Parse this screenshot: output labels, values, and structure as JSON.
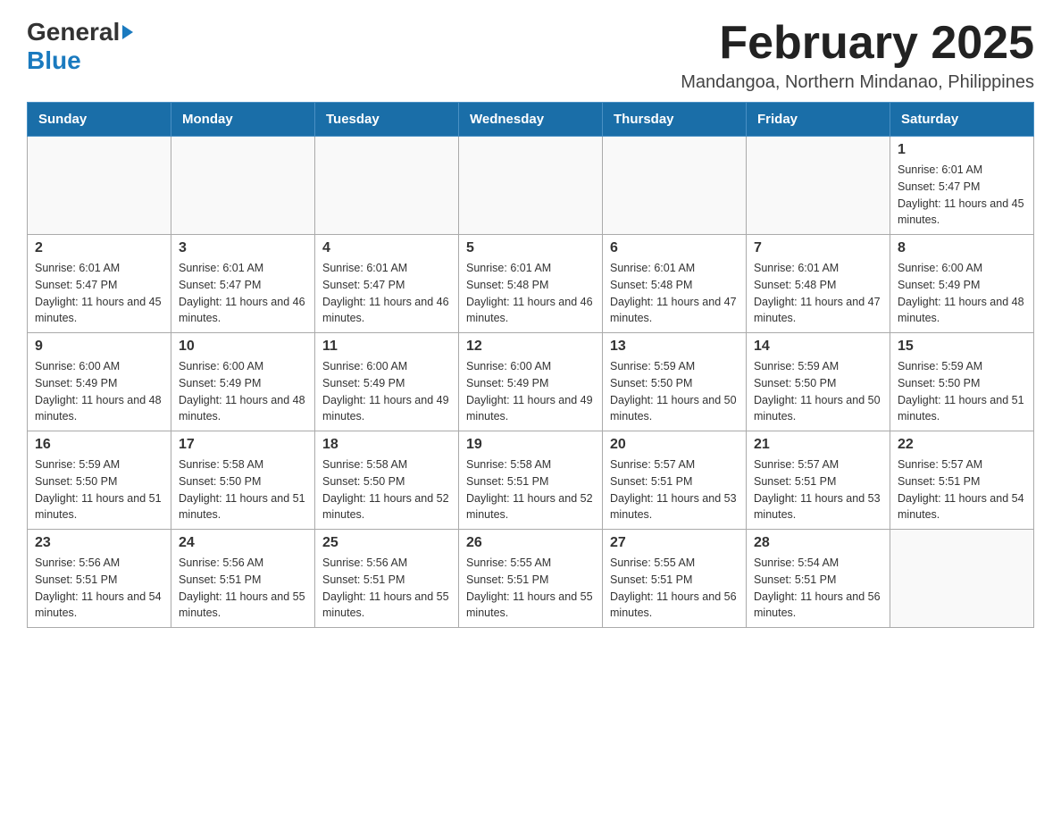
{
  "header": {
    "logo_general": "General",
    "logo_blue": "Blue",
    "month_title": "February 2025",
    "location": "Mandangoa, Northern Mindanao, Philippines"
  },
  "days_of_week": [
    "Sunday",
    "Monday",
    "Tuesday",
    "Wednesday",
    "Thursday",
    "Friday",
    "Saturday"
  ],
  "weeks": [
    {
      "days": [
        {
          "number": "",
          "sunrise": "",
          "sunset": "",
          "daylight": "",
          "empty": true
        },
        {
          "number": "",
          "sunrise": "",
          "sunset": "",
          "daylight": "",
          "empty": true
        },
        {
          "number": "",
          "sunrise": "",
          "sunset": "",
          "daylight": "",
          "empty": true
        },
        {
          "number": "",
          "sunrise": "",
          "sunset": "",
          "daylight": "",
          "empty": true
        },
        {
          "number": "",
          "sunrise": "",
          "sunset": "",
          "daylight": "",
          "empty": true
        },
        {
          "number": "",
          "sunrise": "",
          "sunset": "",
          "daylight": "",
          "empty": true
        },
        {
          "number": "1",
          "sunrise": "Sunrise: 6:01 AM",
          "sunset": "Sunset: 5:47 PM",
          "daylight": "Daylight: 11 hours and 45 minutes.",
          "empty": false
        }
      ]
    },
    {
      "days": [
        {
          "number": "2",
          "sunrise": "Sunrise: 6:01 AM",
          "sunset": "Sunset: 5:47 PM",
          "daylight": "Daylight: 11 hours and 45 minutes.",
          "empty": false
        },
        {
          "number": "3",
          "sunrise": "Sunrise: 6:01 AM",
          "sunset": "Sunset: 5:47 PM",
          "daylight": "Daylight: 11 hours and 46 minutes.",
          "empty": false
        },
        {
          "number": "4",
          "sunrise": "Sunrise: 6:01 AM",
          "sunset": "Sunset: 5:47 PM",
          "daylight": "Daylight: 11 hours and 46 minutes.",
          "empty": false
        },
        {
          "number": "5",
          "sunrise": "Sunrise: 6:01 AM",
          "sunset": "Sunset: 5:48 PM",
          "daylight": "Daylight: 11 hours and 46 minutes.",
          "empty": false
        },
        {
          "number": "6",
          "sunrise": "Sunrise: 6:01 AM",
          "sunset": "Sunset: 5:48 PM",
          "daylight": "Daylight: 11 hours and 47 minutes.",
          "empty": false
        },
        {
          "number": "7",
          "sunrise": "Sunrise: 6:01 AM",
          "sunset": "Sunset: 5:48 PM",
          "daylight": "Daylight: 11 hours and 47 minutes.",
          "empty": false
        },
        {
          "number": "8",
          "sunrise": "Sunrise: 6:00 AM",
          "sunset": "Sunset: 5:49 PM",
          "daylight": "Daylight: 11 hours and 48 minutes.",
          "empty": false
        }
      ]
    },
    {
      "days": [
        {
          "number": "9",
          "sunrise": "Sunrise: 6:00 AM",
          "sunset": "Sunset: 5:49 PM",
          "daylight": "Daylight: 11 hours and 48 minutes.",
          "empty": false
        },
        {
          "number": "10",
          "sunrise": "Sunrise: 6:00 AM",
          "sunset": "Sunset: 5:49 PM",
          "daylight": "Daylight: 11 hours and 48 minutes.",
          "empty": false
        },
        {
          "number": "11",
          "sunrise": "Sunrise: 6:00 AM",
          "sunset": "Sunset: 5:49 PM",
          "daylight": "Daylight: 11 hours and 49 minutes.",
          "empty": false
        },
        {
          "number": "12",
          "sunrise": "Sunrise: 6:00 AM",
          "sunset": "Sunset: 5:49 PM",
          "daylight": "Daylight: 11 hours and 49 minutes.",
          "empty": false
        },
        {
          "number": "13",
          "sunrise": "Sunrise: 5:59 AM",
          "sunset": "Sunset: 5:50 PM",
          "daylight": "Daylight: 11 hours and 50 minutes.",
          "empty": false
        },
        {
          "number": "14",
          "sunrise": "Sunrise: 5:59 AM",
          "sunset": "Sunset: 5:50 PM",
          "daylight": "Daylight: 11 hours and 50 minutes.",
          "empty": false
        },
        {
          "number": "15",
          "sunrise": "Sunrise: 5:59 AM",
          "sunset": "Sunset: 5:50 PM",
          "daylight": "Daylight: 11 hours and 51 minutes.",
          "empty": false
        }
      ]
    },
    {
      "days": [
        {
          "number": "16",
          "sunrise": "Sunrise: 5:59 AM",
          "sunset": "Sunset: 5:50 PM",
          "daylight": "Daylight: 11 hours and 51 minutes.",
          "empty": false
        },
        {
          "number": "17",
          "sunrise": "Sunrise: 5:58 AM",
          "sunset": "Sunset: 5:50 PM",
          "daylight": "Daylight: 11 hours and 51 minutes.",
          "empty": false
        },
        {
          "number": "18",
          "sunrise": "Sunrise: 5:58 AM",
          "sunset": "Sunset: 5:50 PM",
          "daylight": "Daylight: 11 hours and 52 minutes.",
          "empty": false
        },
        {
          "number": "19",
          "sunrise": "Sunrise: 5:58 AM",
          "sunset": "Sunset: 5:51 PM",
          "daylight": "Daylight: 11 hours and 52 minutes.",
          "empty": false
        },
        {
          "number": "20",
          "sunrise": "Sunrise: 5:57 AM",
          "sunset": "Sunset: 5:51 PM",
          "daylight": "Daylight: 11 hours and 53 minutes.",
          "empty": false
        },
        {
          "number": "21",
          "sunrise": "Sunrise: 5:57 AM",
          "sunset": "Sunset: 5:51 PM",
          "daylight": "Daylight: 11 hours and 53 minutes.",
          "empty": false
        },
        {
          "number": "22",
          "sunrise": "Sunrise: 5:57 AM",
          "sunset": "Sunset: 5:51 PM",
          "daylight": "Daylight: 11 hours and 54 minutes.",
          "empty": false
        }
      ]
    },
    {
      "days": [
        {
          "number": "23",
          "sunrise": "Sunrise: 5:56 AM",
          "sunset": "Sunset: 5:51 PM",
          "daylight": "Daylight: 11 hours and 54 minutes.",
          "empty": false
        },
        {
          "number": "24",
          "sunrise": "Sunrise: 5:56 AM",
          "sunset": "Sunset: 5:51 PM",
          "daylight": "Daylight: 11 hours and 55 minutes.",
          "empty": false
        },
        {
          "number": "25",
          "sunrise": "Sunrise: 5:56 AM",
          "sunset": "Sunset: 5:51 PM",
          "daylight": "Daylight: 11 hours and 55 minutes.",
          "empty": false
        },
        {
          "number": "26",
          "sunrise": "Sunrise: 5:55 AM",
          "sunset": "Sunset: 5:51 PM",
          "daylight": "Daylight: 11 hours and 55 minutes.",
          "empty": false
        },
        {
          "number": "27",
          "sunrise": "Sunrise: 5:55 AM",
          "sunset": "Sunset: 5:51 PM",
          "daylight": "Daylight: 11 hours and 56 minutes.",
          "empty": false
        },
        {
          "number": "28",
          "sunrise": "Sunrise: 5:54 AM",
          "sunset": "Sunset: 5:51 PM",
          "daylight": "Daylight: 11 hours and 56 minutes.",
          "empty": false
        },
        {
          "number": "",
          "sunrise": "",
          "sunset": "",
          "daylight": "",
          "empty": true
        }
      ]
    }
  ]
}
